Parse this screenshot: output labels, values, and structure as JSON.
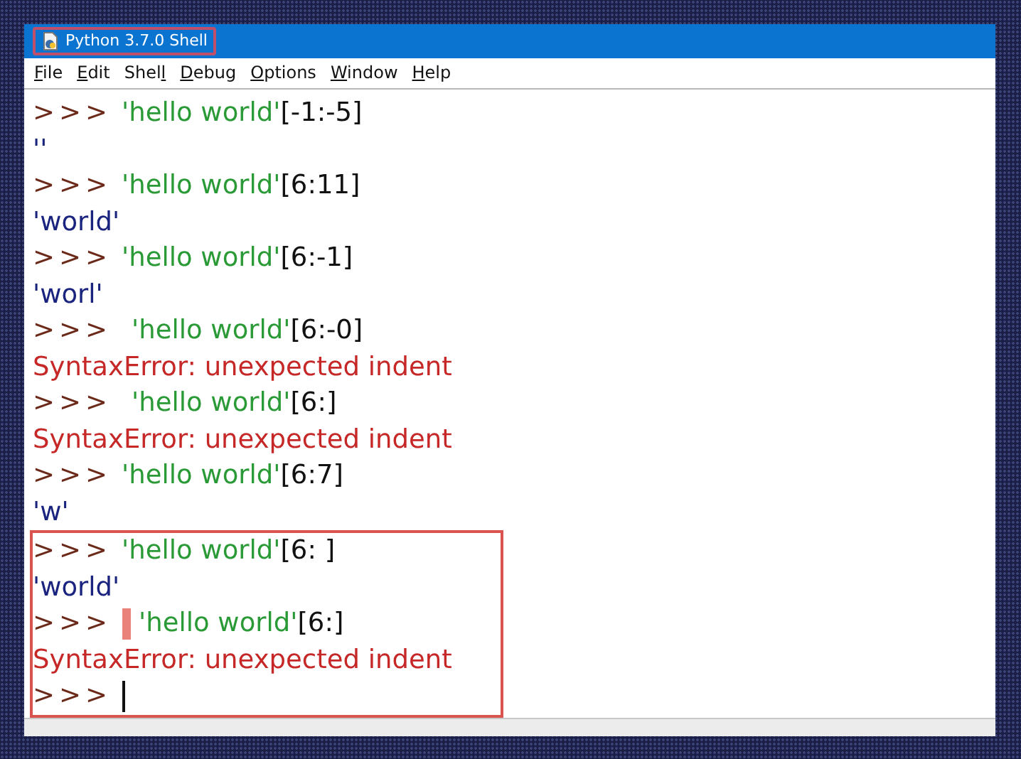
{
  "window": {
    "title": "Python 3.7.0 Shell",
    "title_annotated": true
  },
  "menu": [
    {
      "parts": [
        {
          "text": "F",
          "underlined": true
        },
        {
          "text": "ile",
          "underlined": false
        }
      ]
    },
    {
      "parts": [
        {
          "text": "E",
          "underlined": true
        },
        {
          "text": "dit",
          "underlined": false
        }
      ]
    },
    {
      "parts": [
        {
          "text": "Shel",
          "underlined": false
        },
        {
          "text": "l",
          "underlined": true
        }
      ]
    },
    {
      "parts": [
        {
          "text": "D",
          "underlined": true
        },
        {
          "text": "ebug",
          "underlined": false
        }
      ]
    },
    {
      "parts": [
        {
          "text": "O",
          "underlined": true
        },
        {
          "text": "ptions",
          "underlined": false
        }
      ]
    },
    {
      "parts": [
        {
          "text": "W",
          "underlined": true
        },
        {
          "text": "indow",
          "underlined": false
        }
      ]
    },
    {
      "parts": [
        {
          "text": "H",
          "underlined": true
        },
        {
          "text": "elp",
          "underlined": false
        }
      ]
    }
  ],
  "shell": {
    "lines": [
      {
        "kind": "input",
        "prompt": ">>>",
        "string": "'hello world'",
        "slice": "[-1:-5]",
        "indented": false,
        "boxed": false
      },
      {
        "kind": "output",
        "text": "''",
        "boxed": false
      },
      {
        "kind": "input",
        "prompt": ">>>",
        "string": "'hello world'",
        "slice": "[6:11]",
        "indented": false,
        "boxed": false
      },
      {
        "kind": "output",
        "text": "'world'",
        "boxed": false
      },
      {
        "kind": "input",
        "prompt": ">>>",
        "string": "'hello world'",
        "slice": "[6:-1]",
        "indented": false,
        "boxed": false
      },
      {
        "kind": "output",
        "text": "'worl'",
        "boxed": false
      },
      {
        "kind": "input",
        "prompt": ">>>",
        "string": "'hello world'",
        "slice": "[6:-0]",
        "indented": true,
        "boxed": false
      },
      {
        "kind": "error",
        "text": "SyntaxError: unexpected indent",
        "boxed": false
      },
      {
        "kind": "input",
        "prompt": ">>>",
        "string": "'hello world'",
        "slice": "[6:]",
        "indented": true,
        "boxed": false
      },
      {
        "kind": "error",
        "text": "SyntaxError: unexpected indent",
        "boxed": false
      },
      {
        "kind": "input",
        "prompt": ">>>",
        "string": "'hello world'",
        "slice": "[6:7]",
        "indented": false,
        "boxed": false
      },
      {
        "kind": "output",
        "text": "'w'",
        "boxed": false
      },
      {
        "kind": "input",
        "prompt": ">>>",
        "string": "'hello world'",
        "slice": "[6: ]",
        "indented": false,
        "boxed": true
      },
      {
        "kind": "output",
        "text": "'world'",
        "boxed": true
      },
      {
        "kind": "input",
        "prompt": ">>>",
        "string": "'hello world'",
        "slice": "[6:]",
        "indented": true,
        "marked": true,
        "boxed": true
      },
      {
        "kind": "error",
        "text": "SyntaxError: unexpected indent",
        "boxed": true
      },
      {
        "kind": "prompt",
        "prompt": ">>>",
        "cursor": true,
        "boxed": true
      }
    ]
  }
}
